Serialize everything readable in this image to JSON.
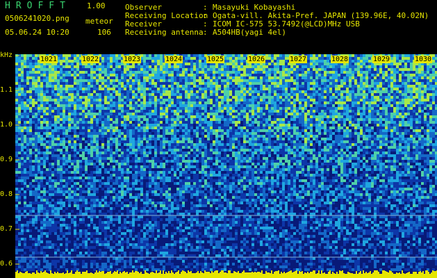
{
  "app": {
    "title": "HROFFT",
    "version": "1.00",
    "filename": "0506241020.png",
    "mode": "meteor",
    "datetime": "05.06.24 10:20",
    "count": "106"
  },
  "info": [
    {
      "label": "Observer",
      "value": "Masayuki Kobayashi"
    },
    {
      "label": "Receiving Location",
      "value": "Ogata-vill. Akita-Pref. JAPAN (139.96E, 40.02N)"
    },
    {
      "label": "Receiver",
      "value": "ICOM IC-575 53.7492(@LCD)MHz USB"
    },
    {
      "label": "Receiving antenna",
      "value": "A504HB(yagi 4el)"
    }
  ],
  "y_axis": {
    "unit": "kHz",
    "ticks": [
      "1.1",
      "1.0",
      "0.9",
      "0.8",
      "0.7",
      "0.6"
    ]
  },
  "x_axis": {
    "ticks": [
      "1021",
      "1022",
      "1023",
      "1024",
      "1025",
      "1026",
      "1027",
      "1028",
      "1029",
      "1030"
    ]
  },
  "colors": {
    "accent_yellow": "#e6e600",
    "title_green": "#39d36f",
    "background": "#000000",
    "spectrum_low": "#0a1a8a",
    "spectrum_mid": "#1e9ad8",
    "spectrum_high": "#9be23c"
  }
}
